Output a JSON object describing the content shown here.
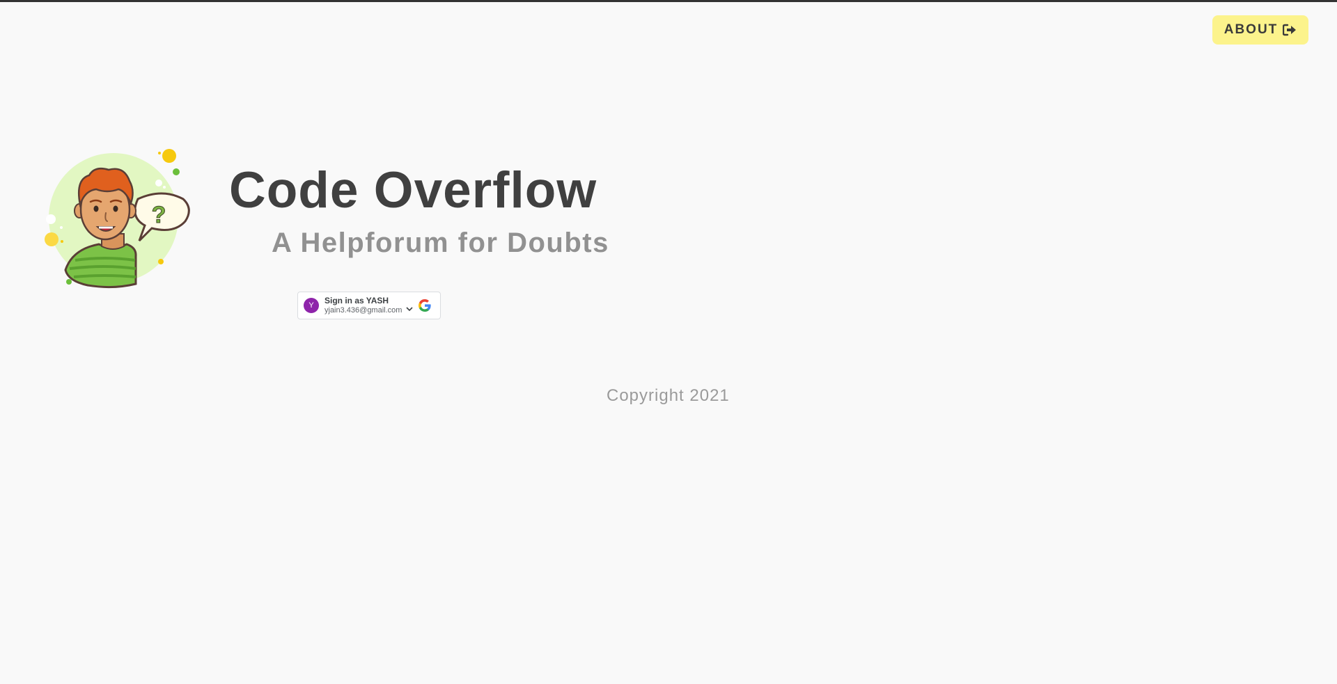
{
  "header": {
    "about_label": "ABOUT",
    "about_icon": "sign-out-icon",
    "about_color": "#fcf38c"
  },
  "hero": {
    "title": "Code Overflow",
    "subtitle": "A Helpforum for Doubts",
    "illustration": "person-with-question-illustration"
  },
  "google_signin": {
    "avatar_letter": "Y",
    "label": "Sign in as YASH",
    "email": "yjain3.436@gmail.com",
    "avatar_color": "#8e24aa",
    "chevron_icon": "chevron-down-icon",
    "logo_icon": "google-logo-icon"
  },
  "footer": {
    "copyright": "Copyright 2021"
  },
  "colors": {
    "background": "#f9f9f9",
    "title": "#404040",
    "subtitle": "#919191",
    "top_border": "#333333"
  }
}
